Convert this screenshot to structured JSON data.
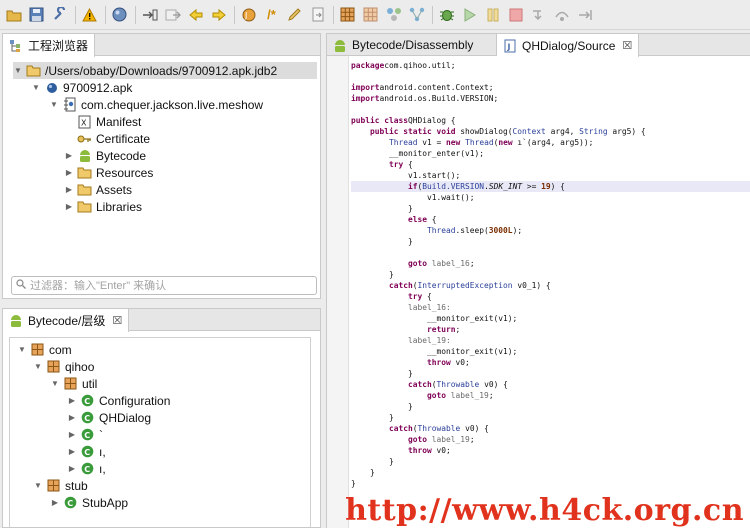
{
  "toolbar": {
    "icons": [
      "open-folder-icon",
      "save-icon",
      "wrench-icon",
      "warning-icon",
      "globe-icon",
      "jump-to-icon",
      "parse-icon",
      "back-arrow-icon",
      "forward-arrow-icon",
      "decompile-icon",
      "comment-icon",
      "pencil-icon",
      "export-icon",
      "grid-icon",
      "grid-alt-icon",
      "nodes-icon",
      "graph-icon",
      "debug-bug-icon",
      "run-icon",
      "pause-icon",
      "stop-icon",
      "step-into-icon",
      "step-over-icon",
      "step-return-icon"
    ]
  },
  "project_panel": {
    "tab_label": "工程浏览器",
    "filter_placeholder": "过滤器：输入\"Enter\" 来确认",
    "tree": [
      {
        "label": "/Users/obaby/Downloads/9700912.apk.jdb2",
        "expanded": true,
        "selected": true
      },
      {
        "label": "9700912.apk",
        "expanded": true
      },
      {
        "label": "com.chequer.jackson.live.meshow",
        "expanded": true
      },
      {
        "label": "Manifest"
      },
      {
        "label": "Certificate"
      },
      {
        "label": "Bytecode",
        "expanded": false
      },
      {
        "label": "Resources",
        "expanded": false
      },
      {
        "label": "Assets",
        "expanded": false
      },
      {
        "label": "Libraries",
        "expanded": false
      }
    ]
  },
  "hierarchy_panel": {
    "tab_label": "Bytecode/层级",
    "tree": [
      {
        "label": "com",
        "expanded": true
      },
      {
        "label": "qihoo",
        "expanded": true
      },
      {
        "label": "util",
        "expanded": true
      },
      {
        "label": "Configuration"
      },
      {
        "label": "QHDialog"
      },
      {
        "label": "`"
      },
      {
        "label": "ı,"
      },
      {
        "label": "ı,"
      },
      {
        "label": "stub",
        "expanded": true
      },
      {
        "label": "StubApp"
      }
    ]
  },
  "editor": {
    "tabs": [
      {
        "label": "Bytecode/Disassembly",
        "active": false
      },
      {
        "label": "QHDialog/Source",
        "active": true
      }
    ],
    "highlight_line": 11,
    "lines": [
      [
        [
          "kw",
          "package"
        ],
        [
          "",
          "com.qihoo.util;"
        ]
      ],
      [],
      [
        [
          "kw",
          "import"
        ],
        [
          "",
          "android.content.Context;"
        ]
      ],
      [
        [
          "kw",
          "import"
        ],
        [
          "",
          "android.os.Build.VERSION;"
        ]
      ],
      [],
      [
        [
          "kw",
          "public class"
        ],
        [
          "",
          "QHDialog {"
        ]
      ],
      [
        [
          "",
          "    "
        ],
        [
          "kw",
          "public static void"
        ],
        [
          "",
          " showDialog("
        ],
        [
          "ty",
          "Context"
        ],
        [
          "",
          " arg4, "
        ],
        [
          "ty",
          "String"
        ],
        [
          "",
          " arg5) {"
        ]
      ],
      [
        [
          "",
          "        "
        ],
        [
          "ty",
          "Thread"
        ],
        [
          "",
          " v1 = "
        ],
        [
          "kw",
          "new"
        ],
        [
          " ",
          " "
        ],
        [
          "ty",
          "Thread"
        ],
        [
          "",
          "("
        ],
        [
          "kw",
          "new"
        ],
        [
          "",
          " ı`(arg4, arg5));"
        ]
      ],
      [
        [
          "",
          "        __monitor_enter(v1);"
        ]
      ],
      [
        [
          "",
          "        "
        ],
        [
          "kw",
          "try"
        ],
        [
          "",
          " {"
        ]
      ],
      [
        [
          "",
          "            v1.start();"
        ]
      ],
      [
        [
          "",
          "            "
        ],
        [
          "kw",
          "if"
        ],
        [
          "",
          "("
        ],
        [
          "ty",
          "Build.VERSION"
        ],
        [
          "",
          "."
        ],
        [
          "it",
          "SDK_INT"
        ],
        [
          "",
          " >= "
        ],
        [
          "num",
          "19"
        ],
        [
          "",
          ") {"
        ]
      ],
      [
        [
          "",
          "                v1.wait();"
        ]
      ],
      [
        [
          "",
          "            }"
        ]
      ],
      [
        [
          "",
          "            "
        ],
        [
          "kw",
          "else"
        ],
        [
          "",
          " {"
        ]
      ],
      [
        [
          "",
          "                "
        ],
        [
          "ty",
          "Thread"
        ],
        [
          "",
          ".sleep("
        ],
        [
          "num",
          "3000L"
        ],
        [
          "",
          ");"
        ]
      ],
      [
        [
          "",
          "            }"
        ]
      ],
      [],
      [
        [
          "",
          "            "
        ],
        [
          "kw",
          "goto"
        ],
        [
          "",
          " "
        ],
        [
          "lbl",
          "label_16"
        ],
        [
          "",
          ";"
        ]
      ],
      [
        [
          "",
          "        }"
        ]
      ],
      [
        [
          "",
          "        "
        ],
        [
          "kw",
          "catch"
        ],
        [
          "",
          "("
        ],
        [
          "ty",
          "InterruptedException"
        ],
        [
          "",
          " v0_1) {"
        ]
      ],
      [
        [
          "",
          "            "
        ],
        [
          "kw",
          "try"
        ],
        [
          "",
          " {"
        ]
      ],
      [
        [
          "",
          "            "
        ],
        [
          "lbl",
          "label_16:"
        ]
      ],
      [
        [
          "",
          "                __monitor_exit(v1);"
        ]
      ],
      [
        [
          "",
          "                "
        ],
        [
          "kw",
          "return"
        ],
        [
          "",
          ";"
        ]
      ],
      [
        [
          "",
          "            "
        ],
        [
          "lbl",
          "label_19:"
        ]
      ],
      [
        [
          "",
          "                __monitor_exit(v1);"
        ]
      ],
      [
        [
          "",
          "                "
        ],
        [
          "kw",
          "throw"
        ],
        [
          "",
          " v0;"
        ]
      ],
      [
        [
          "",
          "            }"
        ]
      ],
      [
        [
          "",
          "            "
        ],
        [
          "kw",
          "catch"
        ],
        [
          "",
          "("
        ],
        [
          "ty",
          "Throwable"
        ],
        [
          "",
          " v0) {"
        ]
      ],
      [
        [
          "",
          "                "
        ],
        [
          "kw",
          "goto"
        ],
        [
          "",
          " "
        ],
        [
          "lbl",
          "label_19"
        ],
        [
          "",
          ";"
        ]
      ],
      [
        [
          "",
          "            }"
        ]
      ],
      [
        [
          "",
          "        }"
        ]
      ],
      [
        [
          "",
          "        "
        ],
        [
          "kw",
          "catch"
        ],
        [
          "",
          "("
        ],
        [
          "ty",
          "Throwable"
        ],
        [
          "",
          " v0) {"
        ]
      ],
      [
        [
          "",
          "            "
        ],
        [
          "kw",
          "goto"
        ],
        [
          "",
          " "
        ],
        [
          "lbl",
          "label_19"
        ],
        [
          "",
          ";"
        ]
      ],
      [
        [
          "",
          "            "
        ],
        [
          "kw",
          "throw"
        ],
        [
          "",
          " v0;"
        ]
      ],
      [
        [
          "",
          "        }"
        ]
      ],
      [
        [
          "",
          "    }"
        ]
      ],
      [
        [
          "",
          "}"
        ]
      ]
    ]
  },
  "watermark": "http://www.h4ck.org.cn"
}
